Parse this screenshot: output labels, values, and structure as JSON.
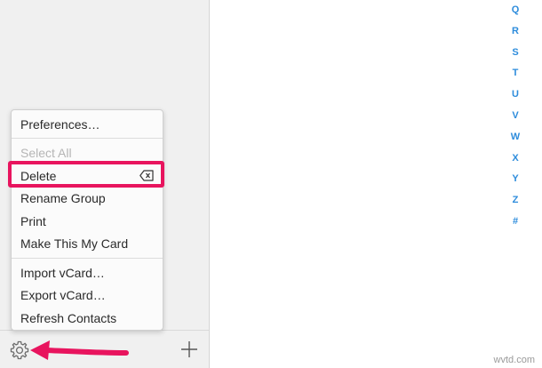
{
  "menu": {
    "items": [
      {
        "label": "Preferences…",
        "enabled": true
      },
      {
        "label": "Select All",
        "enabled": false
      },
      {
        "label": "Delete",
        "enabled": true,
        "shortcut_icon": "delete-key-icon"
      },
      {
        "label": "Rename Group",
        "enabled": true
      },
      {
        "label": "Print",
        "enabled": true
      },
      {
        "label": "Make This My Card",
        "enabled": true
      },
      {
        "label": "Import vCard…",
        "enabled": true
      },
      {
        "label": "Export vCard…",
        "enabled": true
      },
      {
        "label": "Refresh Contacts",
        "enabled": true
      }
    ]
  },
  "sidebar": {
    "bottom_bar": {
      "settings_icon": "gear-icon",
      "add_icon": "plus-icon"
    }
  },
  "alpha_index": [
    "Q",
    "R",
    "S",
    "T",
    "U",
    "V",
    "W",
    "X",
    "Y",
    "Z",
    "#"
  ],
  "colors": {
    "accent_highlight": "#e8145e",
    "index_letters": "#2d8cdc"
  },
  "watermark": "wvtd.com"
}
